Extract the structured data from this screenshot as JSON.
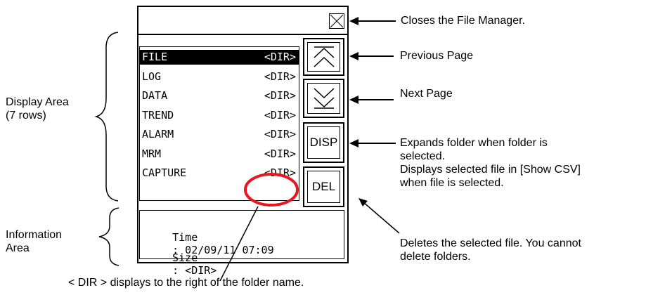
{
  "callouts": {
    "close": "Closes the File Manager.",
    "prev": "Previous Page",
    "next": "Next Page",
    "disp_line1": "Expands folder when folder is",
    "disp_line2": "selected.",
    "disp_line3": "Displays selected file in [Show CSV]",
    "disp_line4": "when file is selected.",
    "del_line1": "Deletes the selected file. You cannot",
    "del_line2": "delete folders.",
    "dir_note": "< DIR > displays to the right of the folder name."
  },
  "regions": {
    "display_line1": "Display Area",
    "display_line2": "(7 rows)",
    "info_line1": "Information",
    "info_line2": "Area"
  },
  "file_list": [
    {
      "name": "FILE",
      "tag": "<DIR>",
      "selected": true
    },
    {
      "name": "LOG",
      "tag": "<DIR>",
      "selected": false
    },
    {
      "name": "DATA",
      "tag": "<DIR>",
      "selected": false
    },
    {
      "name": "TREND",
      "tag": "<DIR>",
      "selected": false
    },
    {
      "name": "ALARM",
      "tag": "<DIR>",
      "selected": false
    },
    {
      "name": "MRM",
      "tag": "<DIR>",
      "selected": false
    },
    {
      "name": "CAPTURE",
      "tag": "<DIR>",
      "selected": false
    }
  ],
  "info": {
    "time_label": "Time",
    "time_value": ": 02/09/11 07:09",
    "size_label": "Size",
    "size_value": ": <DIR>"
  },
  "buttons": {
    "disp": "DISP",
    "del": "DEL"
  },
  "highlight_color": "#e8141e"
}
